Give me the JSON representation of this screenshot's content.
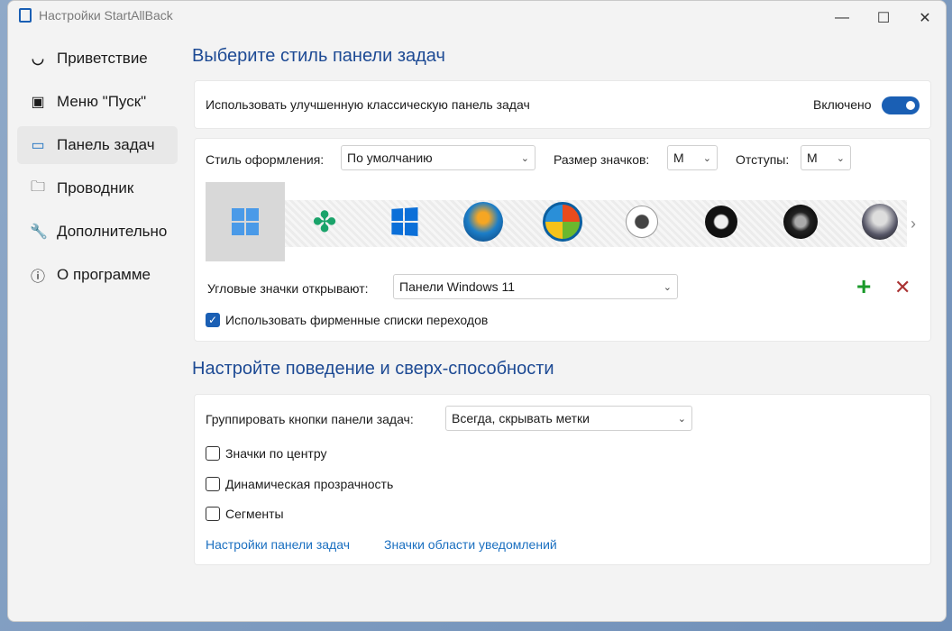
{
  "window": {
    "title": "Настройки StartAllBack",
    "minimize": "—",
    "maximize": "☐",
    "close": "✕"
  },
  "sidebar": {
    "items": [
      {
        "label": "Приветствие",
        "icon": "smile-icon",
        "glyph": "ᵕ̈"
      },
      {
        "label": "Меню \"Пуск\"",
        "icon": "monitor-icon",
        "glyph": "🖳"
      },
      {
        "label": "Панель задач",
        "icon": "taskbar-icon",
        "glyph": "▭"
      },
      {
        "label": "Проводник",
        "icon": "folder-icon",
        "glyph": "🗀"
      },
      {
        "label": "Дополнительно",
        "icon": "wrench-icon",
        "glyph": "🔧"
      },
      {
        "label": "О программе",
        "icon": "info-icon",
        "glyph": "ⓘ"
      }
    ],
    "selected": 2
  },
  "section1": {
    "title": "Выберите стиль панели задач",
    "enhanced_label": "Использовать улучшенную классическую панель задач",
    "enhanced_state": "Включено",
    "style_label": "Стиль оформления:",
    "style_value": "По умолчанию",
    "icon_size_label": "Размер значков:",
    "icon_size_value": "M",
    "padding_label": "Отступы:",
    "padding_value": "M",
    "corner_label": "Угловые значки открывают:",
    "corner_value": "Панели Windows 11",
    "jumplists_label": "Использовать фирменные списки переходов",
    "jumplists_checked": true,
    "add": "+",
    "remove": "✕",
    "next": "›"
  },
  "section2": {
    "title": "Настройте поведение и сверх-способности",
    "group_label": "Группировать кнопки панели задач:",
    "group_value": "Всегда, скрывать метки",
    "checkboxes": [
      {
        "label": "Значки по центру",
        "checked": false
      },
      {
        "label": "Динамическая прозрачность",
        "checked": false
      },
      {
        "label": "Сегменты",
        "checked": false
      }
    ],
    "links": [
      "Настройки панели задач",
      "Значки области уведомлений"
    ]
  },
  "colors": {
    "accent": "#1a5fb4",
    "heading": "#1d4a94",
    "link": "#1a6fc0"
  }
}
